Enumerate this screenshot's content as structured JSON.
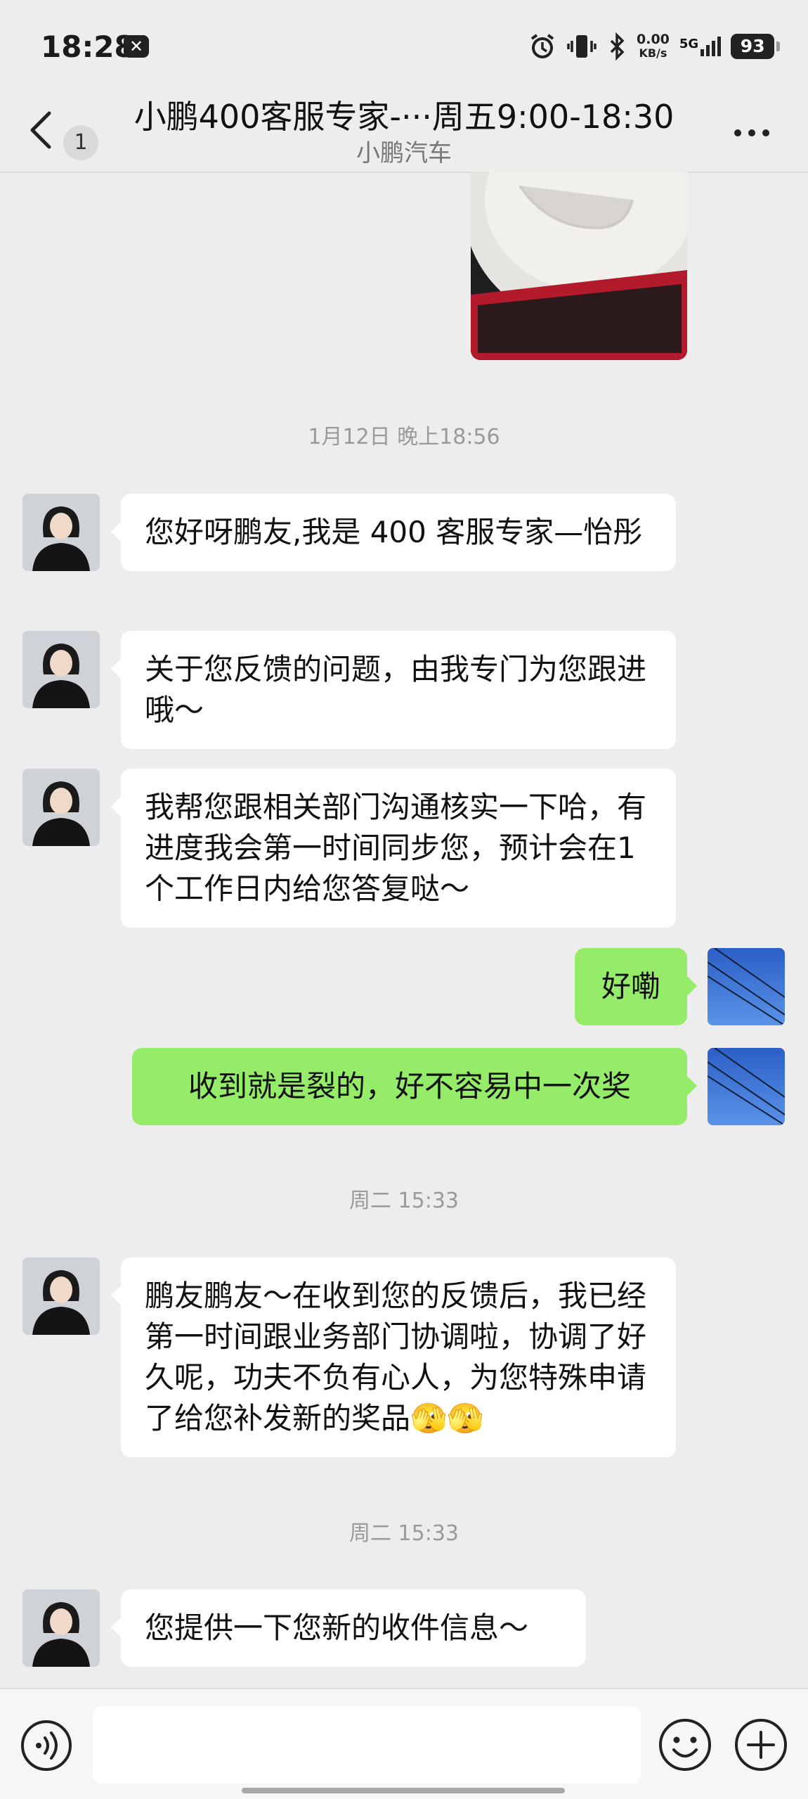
{
  "status": {
    "time": "18:28",
    "net_speed": "0.00",
    "net_unit": "KB/s",
    "signal": "5G",
    "battery": "93"
  },
  "header": {
    "back_count": "1",
    "title": "小鹏400客服专家-···周五9:00-18:30",
    "subtitle": "小鹏汽车"
  },
  "messages": [
    {
      "type": "timestamp",
      "text": "1月12日 晚上18:56"
    },
    {
      "type": "received",
      "text": "您好呀鹏友,我是 400 客服专家—怡彤"
    },
    {
      "type": "received",
      "text": "关于您反馈的问题，由我专门为您跟进哦～"
    },
    {
      "type": "received",
      "text": "我帮您跟相关部门沟通核实一下哈，有进度我会第一时间同步您，预计会在1个工作日内给您答复哒～"
    },
    {
      "type": "sent",
      "text": "好嘞"
    },
    {
      "type": "sent",
      "text": "收到就是裂的，好不容易中一次奖"
    },
    {
      "type": "timestamp",
      "text": "周二 15:33"
    },
    {
      "type": "received",
      "text": "鹏友鹏友～在收到您的反馈后，我已经第一时间跟业务部门协调啦，协调了好久呢，功夫不负有心人，为您特殊申请了给您补发新的奖品🫣🫣"
    },
    {
      "type": "timestamp",
      "text": "周二 15:33"
    },
    {
      "type": "received",
      "text": "您提供一下您新的收件信息～"
    }
  ],
  "input": {
    "placeholder": ""
  },
  "colors": {
    "background": "#ededed",
    "sent_bubble": "#95ec69",
    "received_bubble": "#ffffff"
  }
}
